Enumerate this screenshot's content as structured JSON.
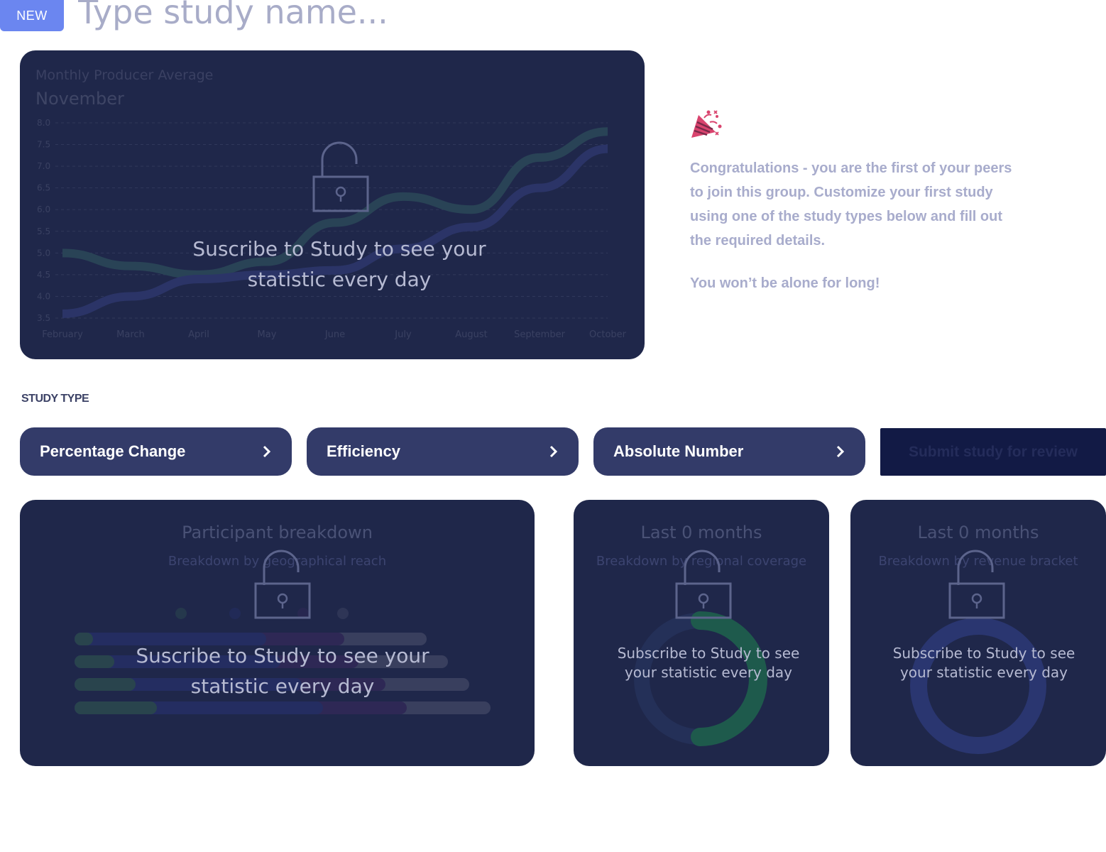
{
  "header": {
    "badge": "NEW",
    "study_name_placeholder": "Type study name..."
  },
  "main_chart": {
    "title": "Monthly Producer Average",
    "period": "November",
    "locked_message": "Suscribe to Study to see your statistic every day",
    "chart_data": {
      "type": "line",
      "x": [
        "February",
        "March",
        "April",
        "May",
        "June",
        "July",
        "August",
        "September",
        "October"
      ],
      "ylim": [
        3.5,
        8.0
      ],
      "yticks": [
        "8.0",
        "7.5",
        "7.0",
        "6.5",
        "6.0",
        "5.5",
        "5.0",
        "4.5",
        "4.0",
        "3.5"
      ],
      "series": [
        {
          "color": "#3c7a55",
          "values": [
            5.0,
            4.7,
            4.5,
            4.8,
            5.7,
            6.3,
            6.0,
            7.2,
            7.8
          ]
        },
        {
          "color": "#2e3a8c",
          "values": [
            3.6,
            4.0,
            4.4,
            4.5,
            4.6,
            5.1,
            5.6,
            6.5,
            7.4
          ]
        }
      ]
    }
  },
  "congrats": {
    "icon": "party-popper-icon",
    "message": "Congratulations - you are the first of your peers to join this group. Customize your first study using one of the study types below and fill out the required details.",
    "note": "You won’t be alone for long!"
  },
  "study_type": {
    "label": "STUDY TYPE",
    "options": [
      {
        "label": "Percentage Change"
      },
      {
        "label": "Efficiency"
      },
      {
        "label": "Absolute Number"
      }
    ],
    "submit_label": "Submit study for review"
  },
  "participant_card": {
    "title": "Participant breakdown",
    "subtitle": "Breakdown by geographical reach",
    "locked_message": "Suscribe to Study to see your statistic every day"
  },
  "regional_card": {
    "title": "Last 0 months",
    "subtitle": "Breakdown by regional coverage",
    "locked_message": "Subscribe to Study to see your statistic every day"
  },
  "revenue_card": {
    "title": "Last 0 months",
    "subtitle": "Breakdown by revenue bracket",
    "locked_message": "Subscribe to Study to see your statistic every day"
  },
  "colors": {
    "card_bg": "#1f274a",
    "button_bg": "#333b69",
    "accent_green": "#3c7a55",
    "accent_blue": "#2e3a8c",
    "badge": "#6b86f0"
  }
}
